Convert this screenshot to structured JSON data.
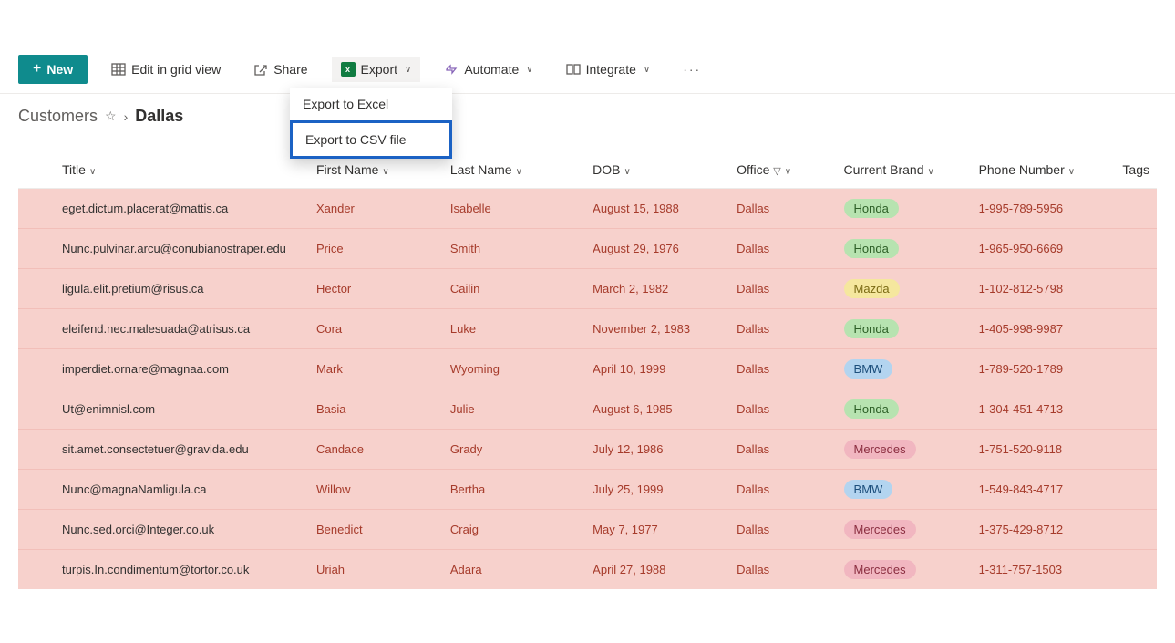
{
  "toolbar": {
    "new_label": "New",
    "edit_grid_label": "Edit in grid view",
    "share_label": "Share",
    "export_label": "Export",
    "automate_label": "Automate",
    "integrate_label": "Integrate"
  },
  "export_menu": {
    "excel": "Export to Excel",
    "csv": "Export to CSV file"
  },
  "breadcrumb": {
    "root": "Customers",
    "current": "Dallas"
  },
  "columns": {
    "title": "Title",
    "first_name": "First Name",
    "last_name": "Last Name",
    "dob": "DOB",
    "office": "Office",
    "current_brand": "Current Brand",
    "phone": "Phone Number",
    "tags": "Tags"
  },
  "brand_styles": {
    "Honda": "brand-honda",
    "Mazda": "brand-mazda",
    "BMW": "brand-bmw",
    "Mercedes": "brand-mercedes"
  },
  "rows": [
    {
      "title": "eget.dictum.placerat@mattis.ca",
      "first_name": "Xander",
      "last_name": "Isabelle",
      "dob": "August 15, 1988",
      "office": "Dallas",
      "brand": "Honda",
      "phone": "1-995-789-5956"
    },
    {
      "title": "Nunc.pulvinar.arcu@conubianostraper.edu",
      "first_name": "Price",
      "last_name": "Smith",
      "dob": "August 29, 1976",
      "office": "Dallas",
      "brand": "Honda",
      "phone": "1-965-950-6669"
    },
    {
      "title": "ligula.elit.pretium@risus.ca",
      "first_name": "Hector",
      "last_name": "Cailin",
      "dob": "March 2, 1982",
      "office": "Dallas",
      "brand": "Mazda",
      "phone": "1-102-812-5798"
    },
    {
      "title": "eleifend.nec.malesuada@atrisus.ca",
      "first_name": "Cora",
      "last_name": "Luke",
      "dob": "November 2, 1983",
      "office": "Dallas",
      "brand": "Honda",
      "phone": "1-405-998-9987"
    },
    {
      "title": "imperdiet.ornare@magnaa.com",
      "first_name": "Mark",
      "last_name": "Wyoming",
      "dob": "April 10, 1999",
      "office": "Dallas",
      "brand": "BMW",
      "phone": "1-789-520-1789"
    },
    {
      "title": "Ut@enimnisl.com",
      "first_name": "Basia",
      "last_name": "Julie",
      "dob": "August 6, 1985",
      "office": "Dallas",
      "brand": "Honda",
      "phone": "1-304-451-4713"
    },
    {
      "title": "sit.amet.consectetuer@gravida.edu",
      "first_name": "Candace",
      "last_name": "Grady",
      "dob": "July 12, 1986",
      "office": "Dallas",
      "brand": "Mercedes",
      "phone": "1-751-520-9118"
    },
    {
      "title": "Nunc@magnaNamligula.ca",
      "first_name": "Willow",
      "last_name": "Bertha",
      "dob": "July 25, 1999",
      "office": "Dallas",
      "brand": "BMW",
      "phone": "1-549-843-4717"
    },
    {
      "title": "Nunc.sed.orci@Integer.co.uk",
      "first_name": "Benedict",
      "last_name": "Craig",
      "dob": "May 7, 1977",
      "office": "Dallas",
      "brand": "Mercedes",
      "phone": "1-375-429-8712"
    },
    {
      "title": "turpis.In.condimentum@tortor.co.uk",
      "first_name": "Uriah",
      "last_name": "Adara",
      "dob": "April 27, 1988",
      "office": "Dallas",
      "brand": "Mercedes",
      "phone": "1-311-757-1503"
    }
  ]
}
